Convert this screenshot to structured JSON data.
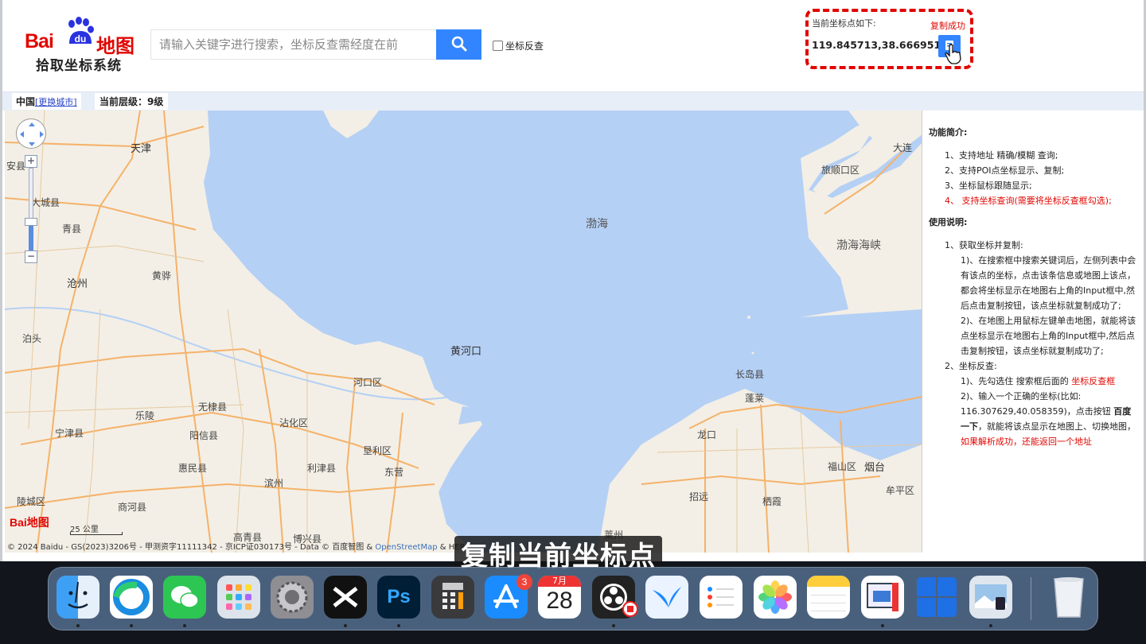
{
  "header": {
    "logo_bai": "Bai",
    "logo_du": "du",
    "logo_map": "地图",
    "logo_subtitle": "拾取坐标系统",
    "search_placeholder": "请输入关键字进行搜索，坐标反查需经度在前",
    "reverse_lookup_label": "坐标反查"
  },
  "coords": {
    "label": "当前坐标点如下:",
    "copy_status": "复制成功",
    "value": "119.845713,38.666951"
  },
  "infobar": {
    "city": "中国",
    "change_city": "[更换城市]",
    "level": "当前层级：9级"
  },
  "map": {
    "labels": [
      "天津",
      "安县",
      "大城县",
      "青县",
      "沧州",
      "黄骅",
      "泊头",
      "渤海",
      "渤海海峡",
      "旅顺口区",
      "大连",
      "黄河口",
      "河口区",
      "长岛县",
      "蓬莱",
      "无棣县",
      "乐陵",
      "沾化区",
      "宁津县",
      "阳信县",
      "垦利区",
      "龙口",
      "惠民县",
      "利津县",
      "东营",
      "福山区",
      "烟台",
      "滨州",
      "牟平区",
      "陵城区",
      "商河县",
      "招远",
      "栖霞",
      "高青县",
      "博兴县",
      "莱州"
    ],
    "scale": "25 公里",
    "logo": "Bai地图",
    "copyright_prefix": "© 2024 Baidu - GS(2023)3206号 - 甲测资字11111342 - 京ICP证030173号 - Data © 百度智图 &",
    "copyright_osm": "OpenStreetMap",
    "copyright_suffix": "& HER"
  },
  "panel": {
    "intro_title": "功能简介:",
    "intro_items": [
      "1、支持地址 精确/模糊 查询;",
      "2、支持POI点坐标显示、复制;",
      "3、坐标鼠标跟随显示;",
      "4、 支持坐标查询(需要将坐标反查框勾选);"
    ],
    "usage_title": "使用说明:",
    "usage_1": "1、获取坐标并复制:",
    "usage_1_1": "1)、在搜索框中搜索关键词后，左侧列表中会有该点的坐标，点击该条信息或地图上该点，都会将坐标显示在地图右上角的Input框中,然后点击复制按钮，该点坐标就复制成功了;",
    "usage_1_2": "2)、在地图上用鼠标左键单击地图，就能将该点坐标显示在地图右上角的Input框中,然后点击复制按钮，该点坐标就复制成功了;",
    "usage_2": "2、坐标反查:",
    "usage_2_1a": "1)、先勾选住 搜索框后面的",
    "usage_2_1b": "坐标反查框",
    "usage_2_2a": "2)、输入一个正确的坐标(比如: 116.307629,40.058359)，点击按钮",
    "usage_2_2b": "百度一下",
    "usage_2_2c": "，就能将该点显示在地图上、切换地图，",
    "usage_2_2d": "如果解析成功，还能返回一个地址"
  },
  "subtitle": "复制当前坐标点",
  "dock": {
    "calendar_month": "7月",
    "calendar_day": "28",
    "appstore_badge": "3",
    "apps": [
      "finder-icon",
      "edge-icon",
      "wechat-icon",
      "launchpad-icon",
      "system-settings-icon",
      "capcut-icon",
      "photoshop-icon",
      "calculator-icon",
      "app-store-icon",
      "calendar-icon",
      "obs-icon",
      "xunlei-icon",
      "reminders-icon",
      "photos-icon",
      "notes-icon",
      "screen-capture-icon",
      "windows-icon",
      "preview-icon",
      "trash-icon"
    ]
  },
  "colors": {
    "accent": "#3385ff",
    "brand_red": "#e10602",
    "sea": "#b5d0f5",
    "land": "#f3efe6"
  }
}
